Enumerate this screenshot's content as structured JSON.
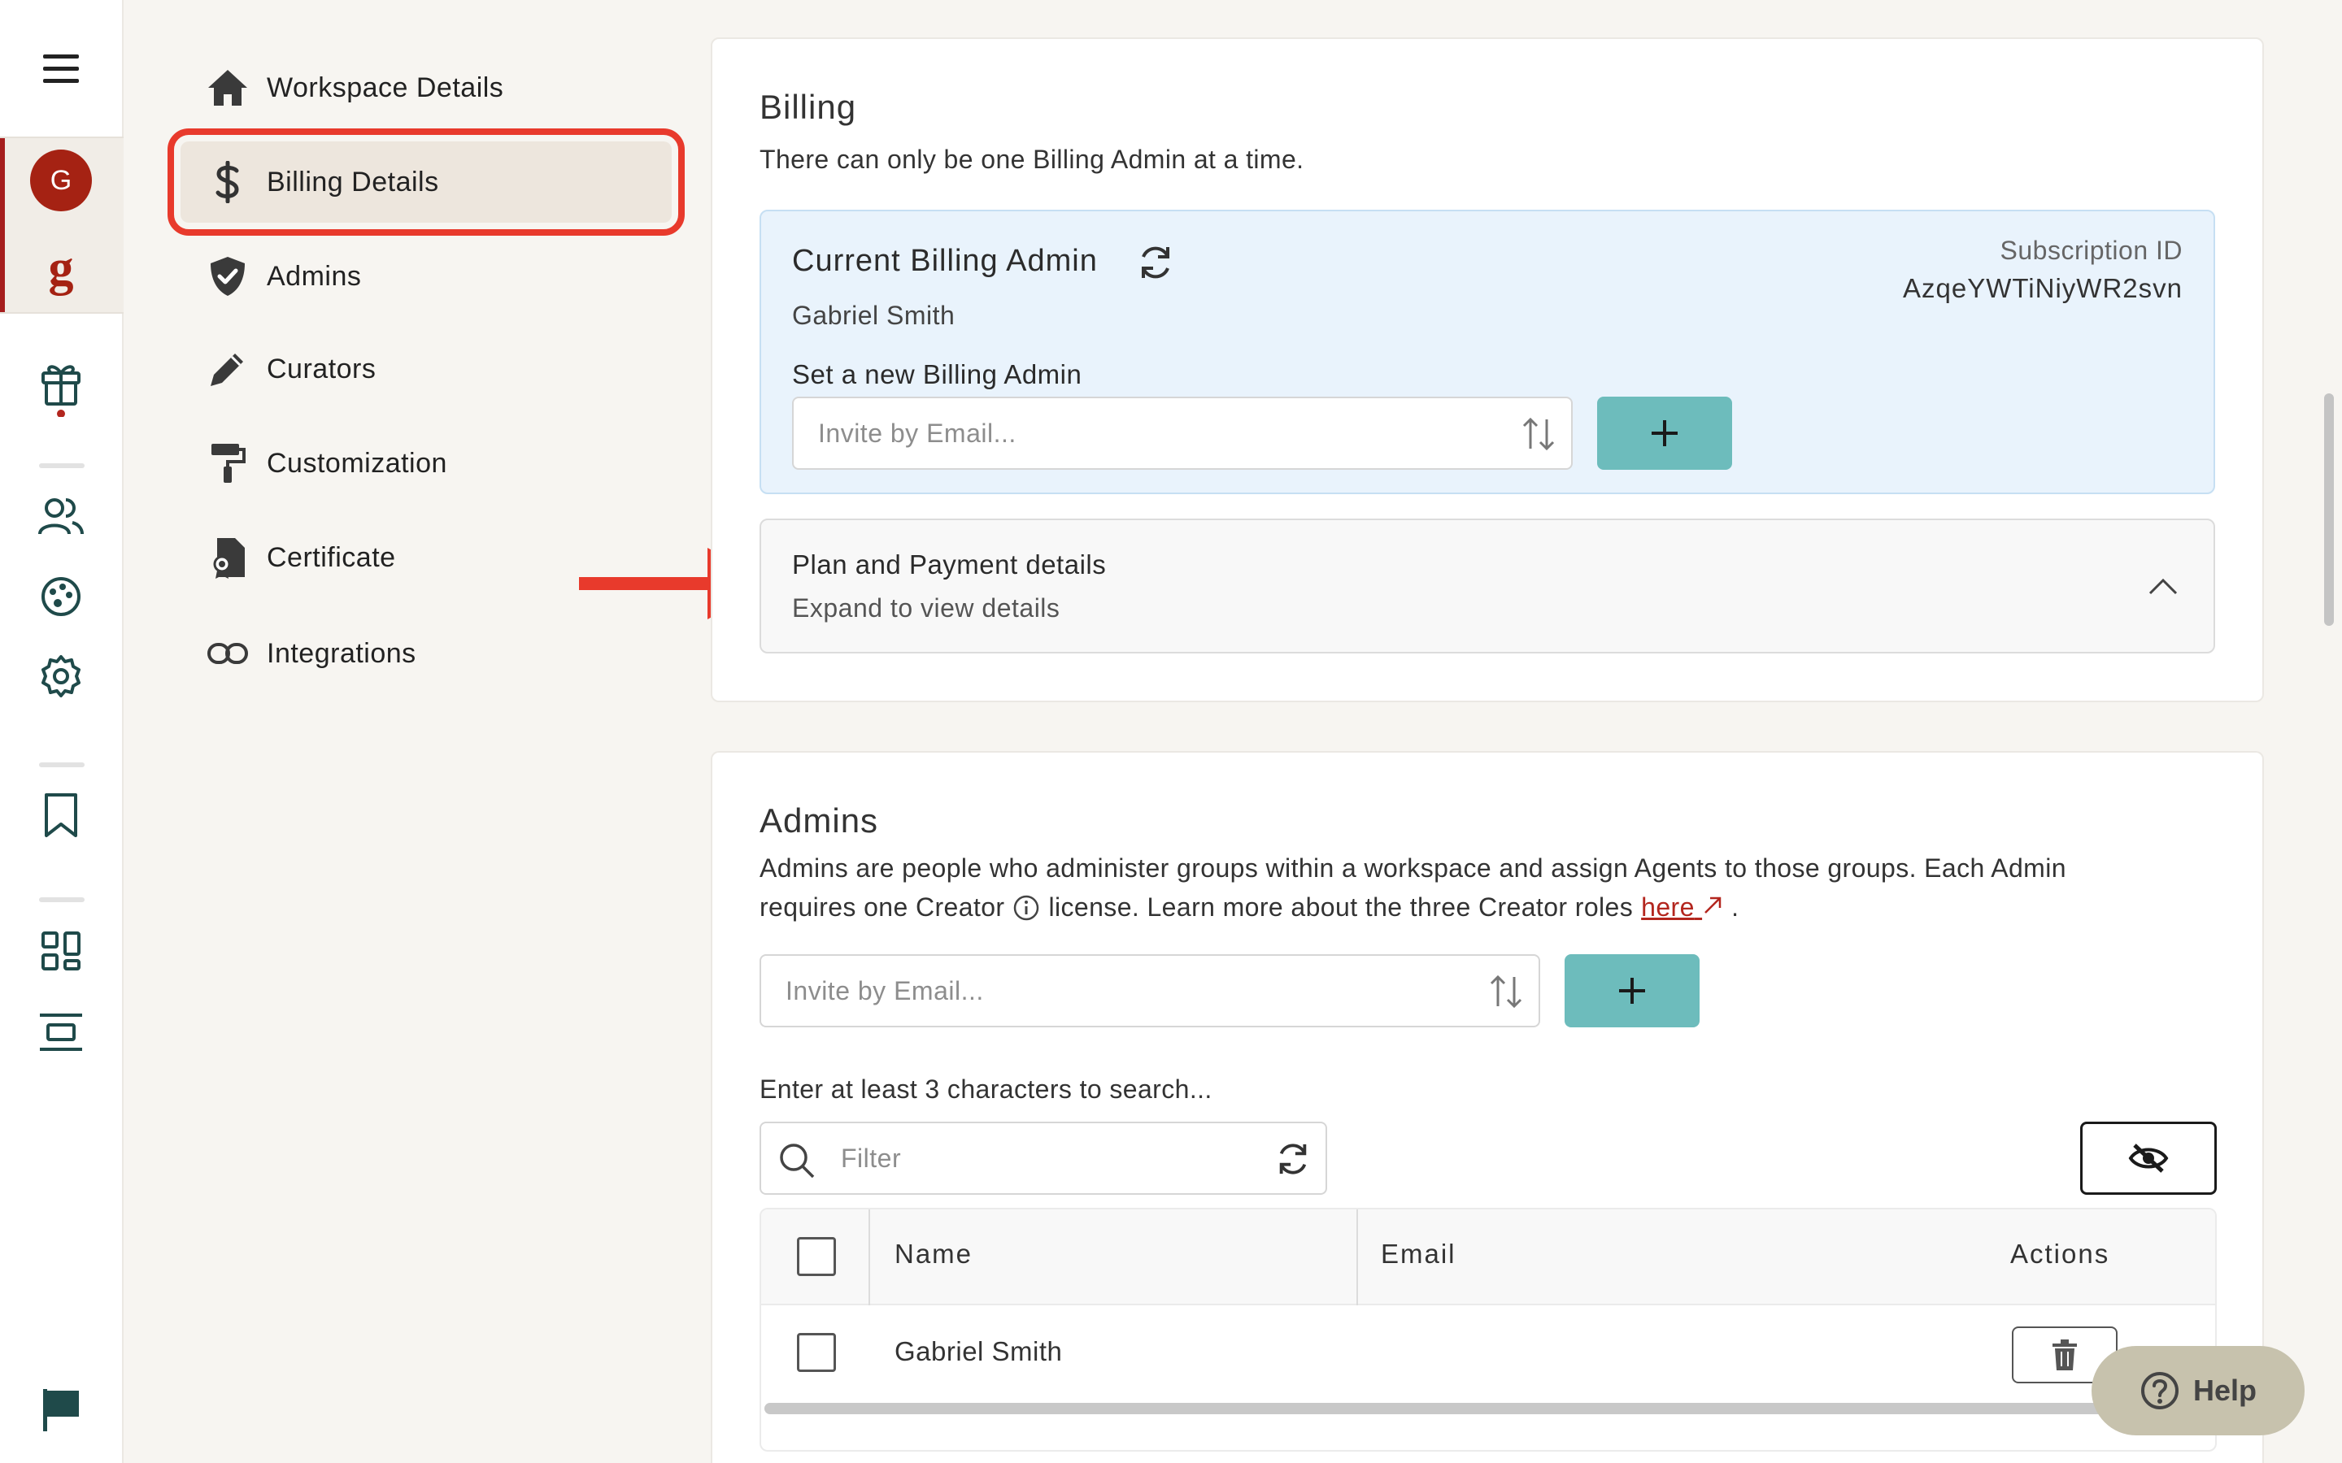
{
  "rail": {
    "avatar_letter": "G",
    "logo_letter": "g",
    "icons": [
      "menu-icon",
      "gift-icon",
      "users-icon",
      "palette-icon",
      "settings-icon",
      "bookmark-icon",
      "dashboard-icon",
      "align-center-icon",
      "flag-icon"
    ]
  },
  "nav": {
    "items": [
      {
        "label": "Workspace Details",
        "icon": "home-icon"
      },
      {
        "label": "Billing Details",
        "icon": "dollar-icon",
        "active": true
      },
      {
        "label": "Admins",
        "icon": "shield-icon"
      },
      {
        "label": "Curators",
        "icon": "pencil-icon"
      },
      {
        "label": "Customization",
        "icon": "paint-roller-icon"
      },
      {
        "label": "Certificate",
        "icon": "certificate-icon"
      },
      {
        "label": "Integrations",
        "icon": "link-icon"
      }
    ]
  },
  "billing": {
    "title": "Billing",
    "subtitle": "There can only be one Billing Admin at a time.",
    "current_admin_label": "Current Billing Admin",
    "current_admin_name": "Gabriel Smith",
    "subscription_label": "Subscription ID",
    "subscription_id": "AzqeYWTiNiyWR2svn",
    "new_admin_label": "Set a new Billing Admin",
    "invite_placeholder": "Invite by Email...",
    "plan_title": "Plan and Payment details",
    "plan_sub": "Expand to view details"
  },
  "admins": {
    "title": "Admins",
    "desc_line1": "Admins are people who administer groups within a workspace and assign Agents to those groups. Each Admin",
    "desc_line2_a": "requires one Creator",
    "desc_line2_b": "license. Learn more about the three Creator roles",
    "link_text": "here",
    "invite_placeholder": "Invite by Email...",
    "search_hint": "Enter at least 3 characters to search...",
    "filter_placeholder": "Filter",
    "columns": {
      "name": "Name",
      "email": "Email",
      "actions": "Actions"
    },
    "rows": [
      {
        "name": "Gabriel Smith",
        "email": ""
      }
    ]
  },
  "help": {
    "label": "Help"
  },
  "colors": {
    "accent": "#6dbcbc",
    "brand": "#a52213",
    "highlight": "#e83a2c"
  }
}
